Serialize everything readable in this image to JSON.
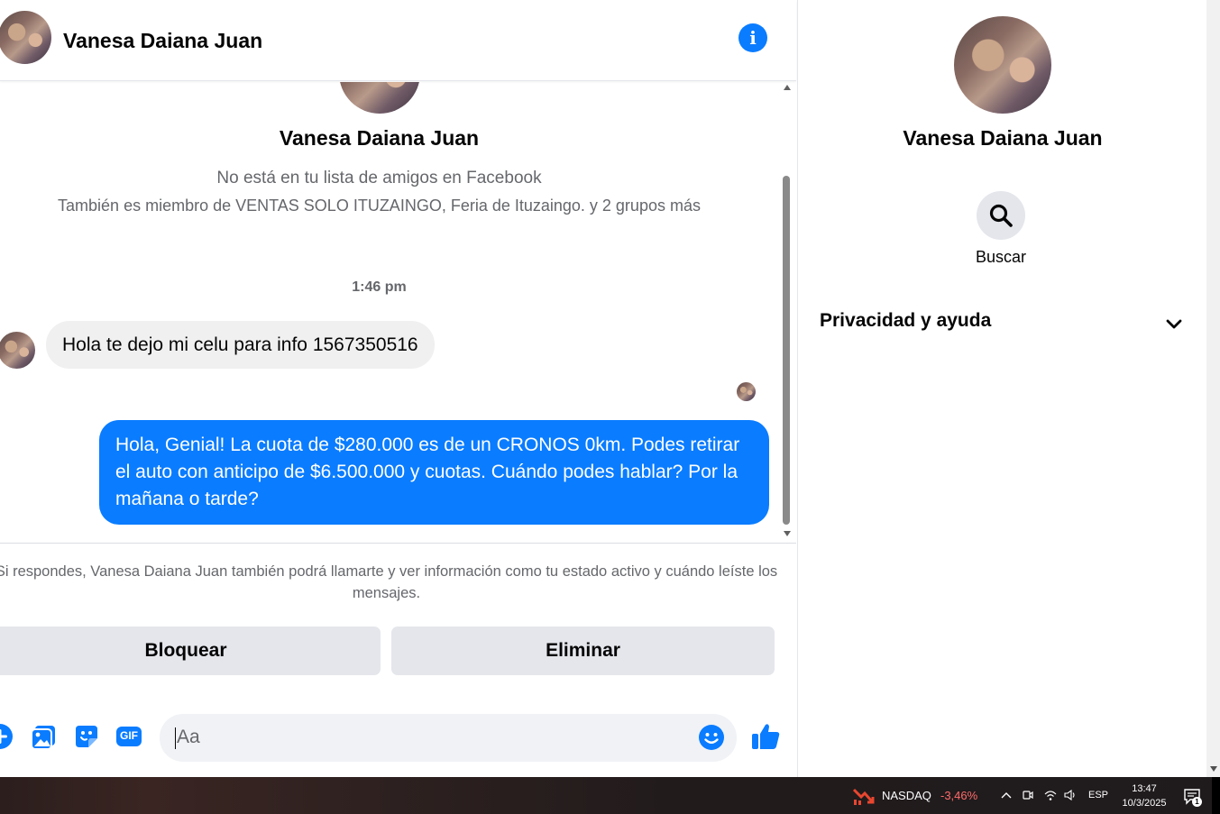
{
  "header": {
    "contact_name": "Vanesa Daiana Juan"
  },
  "conversation": {
    "intro": {
      "name": "Vanesa Daiana Juan",
      "relationship": "No está en tu lista de amigos en Facebook",
      "groups": "También es miembro de VENTAS SOLO ITUZAINGO, Feria de Ituzaingo. y 2 grupos más"
    },
    "timestamp": "1:46 pm",
    "messages": [
      {
        "direction": "incoming",
        "text": "Hola te dejo mi celu para info 1567350516"
      },
      {
        "direction": "outgoing",
        "text": "Hola, Genial! La cuota de $280.000 es de un CRONOS 0km. Podes retirar el auto con anticipo de $6.500.000 y cuotas. Cuándo podes hablar? Por la mañana o tarde?"
      }
    ]
  },
  "request": {
    "notice": "Si respondes, Vanesa Daiana Juan también podrá llamarte y ver información como tu estado activo y cuándo leíste los mensajes.",
    "block_label": "Bloquear",
    "delete_label": "Eliminar"
  },
  "composer": {
    "placeholder": "Aa",
    "gif_label": "GIF"
  },
  "right_panel": {
    "name": "Vanesa Daiana Juan",
    "search_label": "Buscar",
    "privacy_label": "Privacidad y ayuda"
  },
  "taskbar": {
    "ticker_name": "NASDAQ",
    "ticker_change": "-3,46%",
    "language": "ESP",
    "time": "13:47",
    "date": "10/3/2025",
    "notification_count": "1"
  },
  "colors": {
    "accent": "#0a7cff",
    "incoming_bubble": "#f0f0f0",
    "button_gray": "#e4e6eb",
    "secondary_text": "#65676b",
    "ticker_negative": "#ff6b6b"
  }
}
